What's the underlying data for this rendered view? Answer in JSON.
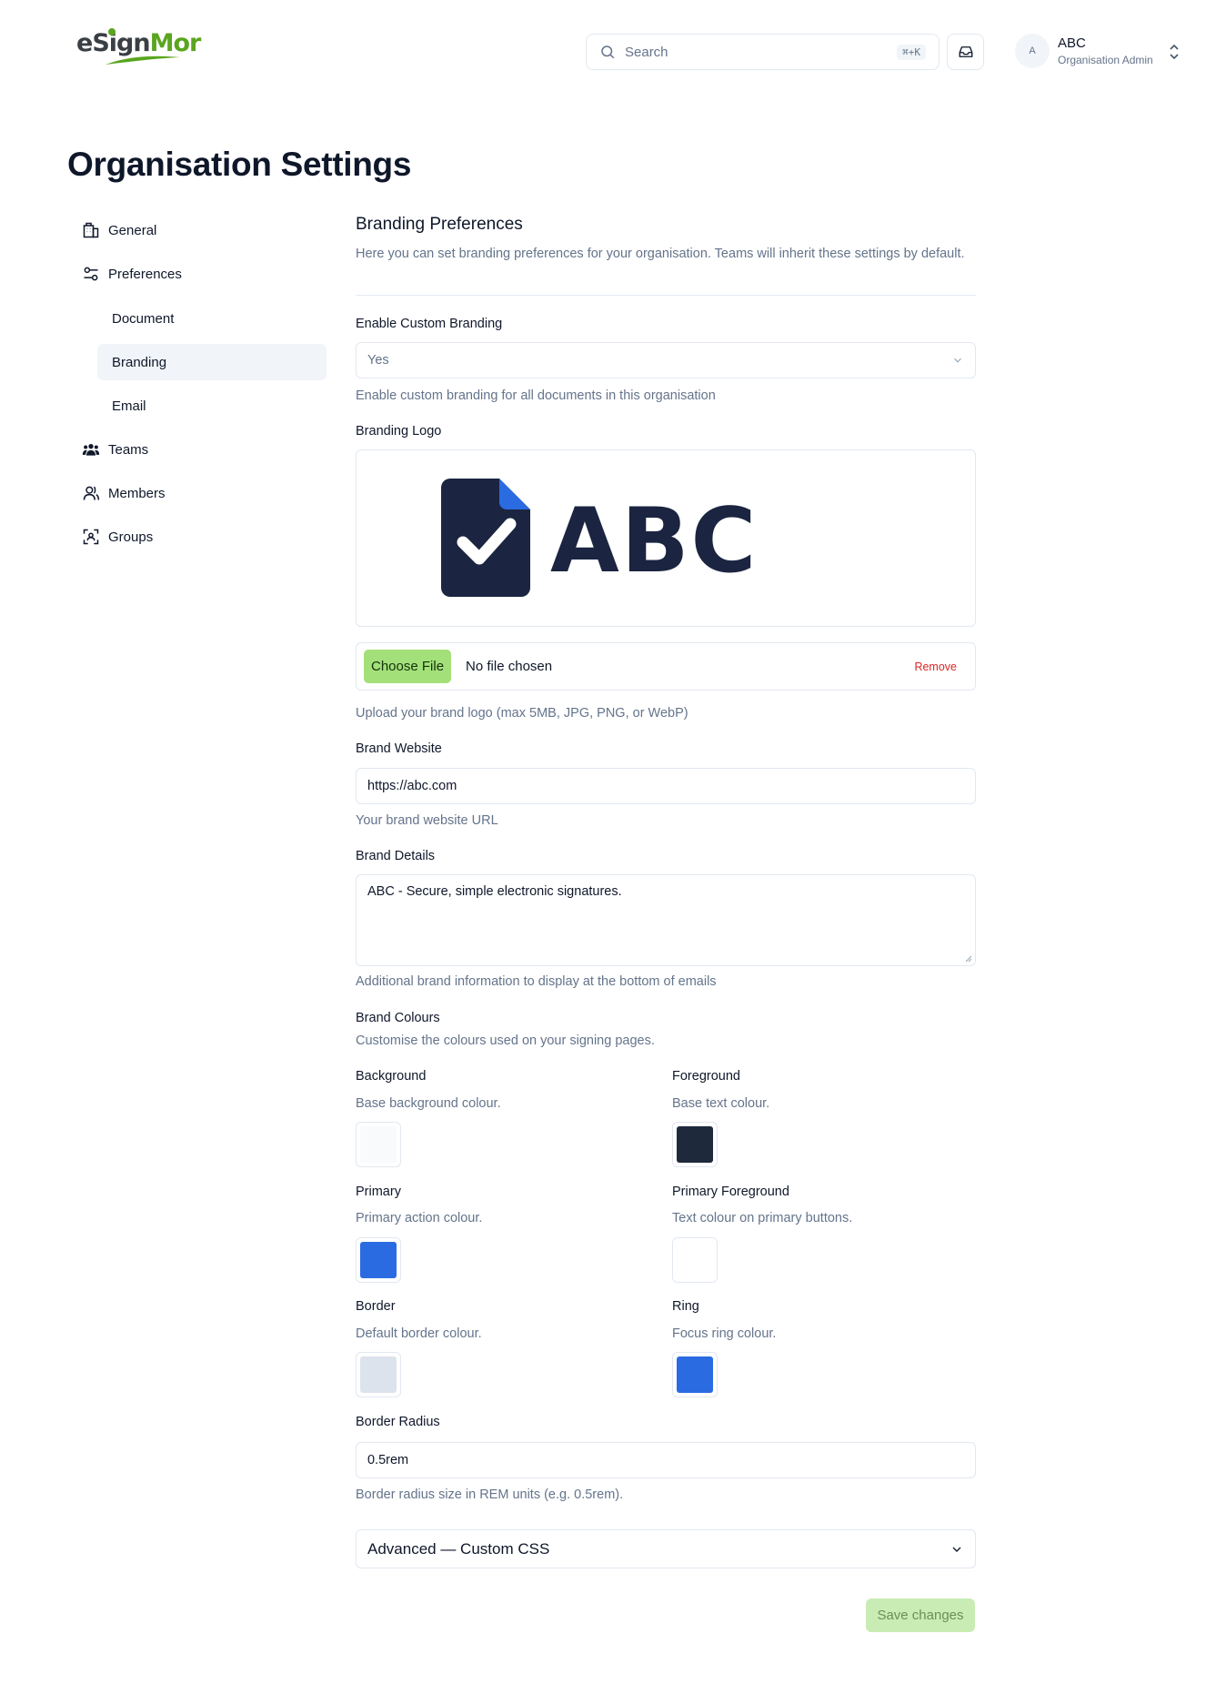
{
  "header": {
    "logo": {
      "part1": "e",
      "part2": "S",
      "part3": "ign",
      "part4": "Mor"
    },
    "search": {
      "placeholder": "Search",
      "shortcut": "⌘+K"
    },
    "user": {
      "initial": "A",
      "name": "ABC",
      "role": "Organisation Admin"
    }
  },
  "page_title": "Organisation Settings",
  "sidebar": {
    "general": "General",
    "preferences": "Preferences",
    "document": "Document",
    "branding": "Branding",
    "email": "Email",
    "teams": "Teams",
    "members": "Members",
    "groups": "Groups"
  },
  "branding": {
    "title": "Branding Preferences",
    "description": "Here you can set branding preferences for your organisation. Teams will inherit these settings by default.",
    "enable_label": "Enable Custom Branding",
    "enable_value": "Yes",
    "enable_helper": "Enable custom branding for all documents in this organisation",
    "logo_label": "Branding Logo",
    "logo_text": "ABC",
    "choose_file": "Choose File",
    "no_file": "No file chosen",
    "remove": "Remove",
    "logo_helper": "Upload your brand logo (max 5MB, JPG, PNG, or WebP)",
    "website_label": "Brand Website",
    "website_value": "https://abc.com",
    "website_helper": "Your brand website URL",
    "details_label": "Brand Details",
    "details_value": "ABC - Secure, simple electronic signatures.",
    "details_helper": "Additional brand information to display at the bottom of emails",
    "colours_label": "Brand Colours",
    "colours_helper": "Customise the colours used on your signing pages.",
    "colours": {
      "background": {
        "label": "Background",
        "helper": "Base background colour.",
        "value": "#f8fafc"
      },
      "foreground": {
        "label": "Foreground",
        "helper": "Base text colour.",
        "value": "#1e293b"
      },
      "primary": {
        "label": "Primary",
        "helper": "Primary action colour.",
        "value": "#2a6be2"
      },
      "primary_foreground": {
        "label": "Primary Foreground",
        "helper": "Text colour on primary buttons.",
        "value": "#ffffff"
      },
      "border": {
        "label": "Border",
        "helper": "Default border colour.",
        "value": "#dde3ec"
      },
      "ring": {
        "label": "Ring",
        "helper": "Focus ring colour.",
        "value": "#2a6be2"
      }
    },
    "radius_label": "Border Radius",
    "radius_value": "0.5rem",
    "radius_helper": "Border radius size in REM units (e.g. 0.5rem).",
    "advanced_label": "Advanced — Custom CSS",
    "save_label": "Save changes"
  }
}
